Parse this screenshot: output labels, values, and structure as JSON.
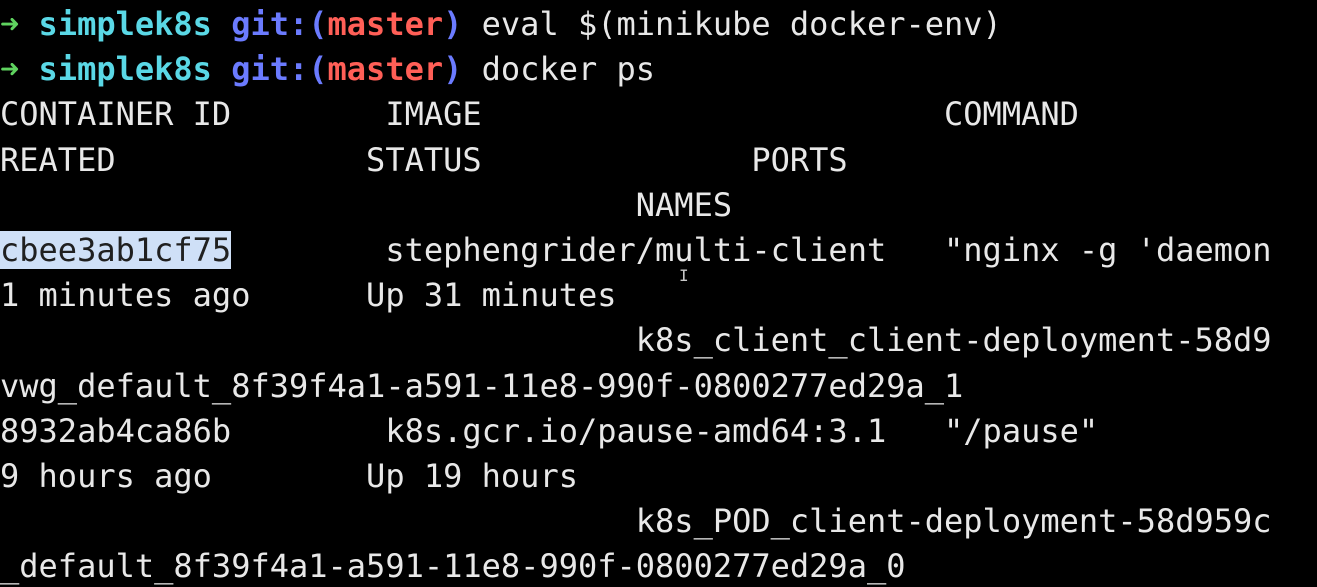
{
  "prompt": {
    "arrow": "➜",
    "directory": "simplek8s",
    "git_prefix": "git:(",
    "branch": "master",
    "git_suffix": ")"
  },
  "commands": [
    "eval $(minikube docker-env)",
    "docker ps"
  ],
  "header": {
    "row1": {
      "container_id": "CONTAINER ID",
      "image": "IMAGE",
      "command": "COMMAND"
    },
    "row2": {
      "created": "REATED",
      "status": "STATUS",
      "ports": "PORTS"
    },
    "row3": {
      "names": "NAMES"
    }
  },
  "containers": [
    {
      "id": "cbee3ab1cf75",
      "image": "stephengrider/multi-client",
      "command": "\"nginx -g 'daemon",
      "created": "1 minutes ago",
      "status": "Up 31 minutes",
      "name_part1": "k8s_client_client-deployment-58d9",
      "name_part2": "vwg_default_8f39f4a1-a591-11e8-990f-0800277ed29a_1"
    },
    {
      "id": "8932ab4ca86b",
      "image": "k8s.gcr.io/pause-amd64:3.1",
      "command": "\"/pause\"",
      "created": "9 hours ago",
      "status": "Up 19 hours",
      "name_part1": "k8s_POD_client-deployment-58d959c",
      "name_part2": "_default_8f39f4a1-a591-11e8-990f-0800277ed29a_0"
    }
  ],
  "colors": {
    "background": "#000000",
    "arrow": "#5fd35f",
    "directory": "#5ad8e6",
    "git": "#6b7bff",
    "branch": "#ff5f57",
    "text": "#e8e8e8",
    "selection": "#cfe0f7"
  },
  "icons": {
    "cursor": "ibeam-cursor-icon"
  }
}
